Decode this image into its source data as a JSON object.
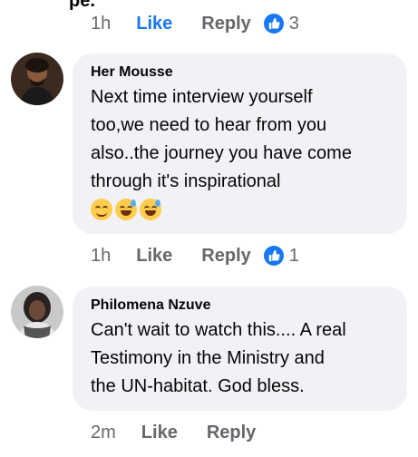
{
  "top_cut_text": "pe.",
  "top_actions": {
    "time": "1h",
    "like": "Like",
    "reply": "Reply",
    "reaction_count": "3"
  },
  "comments": [
    {
      "author": "Her Mousse",
      "lines": [
        "Next time interview yourself",
        "too,we need to hear from you",
        "also..the journey you have come",
        "through it's inspirational"
      ],
      "emojis": [
        "relieved-face-emoji",
        "grinning-sweat-emoji",
        "grinning-sweat-emoji"
      ],
      "time": "1h",
      "like": "Like",
      "reply": "Reply",
      "reaction_count": "1"
    },
    {
      "author": "Philomena Nzuve",
      "lines": [
        "Can't wait to watch this.... A real",
        "Testimony in the Ministry and",
        "the UN-habitat. God bless."
      ],
      "time": "2m",
      "like": "Like",
      "reply": "Reply"
    }
  ],
  "colors": {
    "accent": "#1877f2",
    "meta": "#65676b",
    "bubble": "#f0f2f5",
    "text": "#050505"
  }
}
